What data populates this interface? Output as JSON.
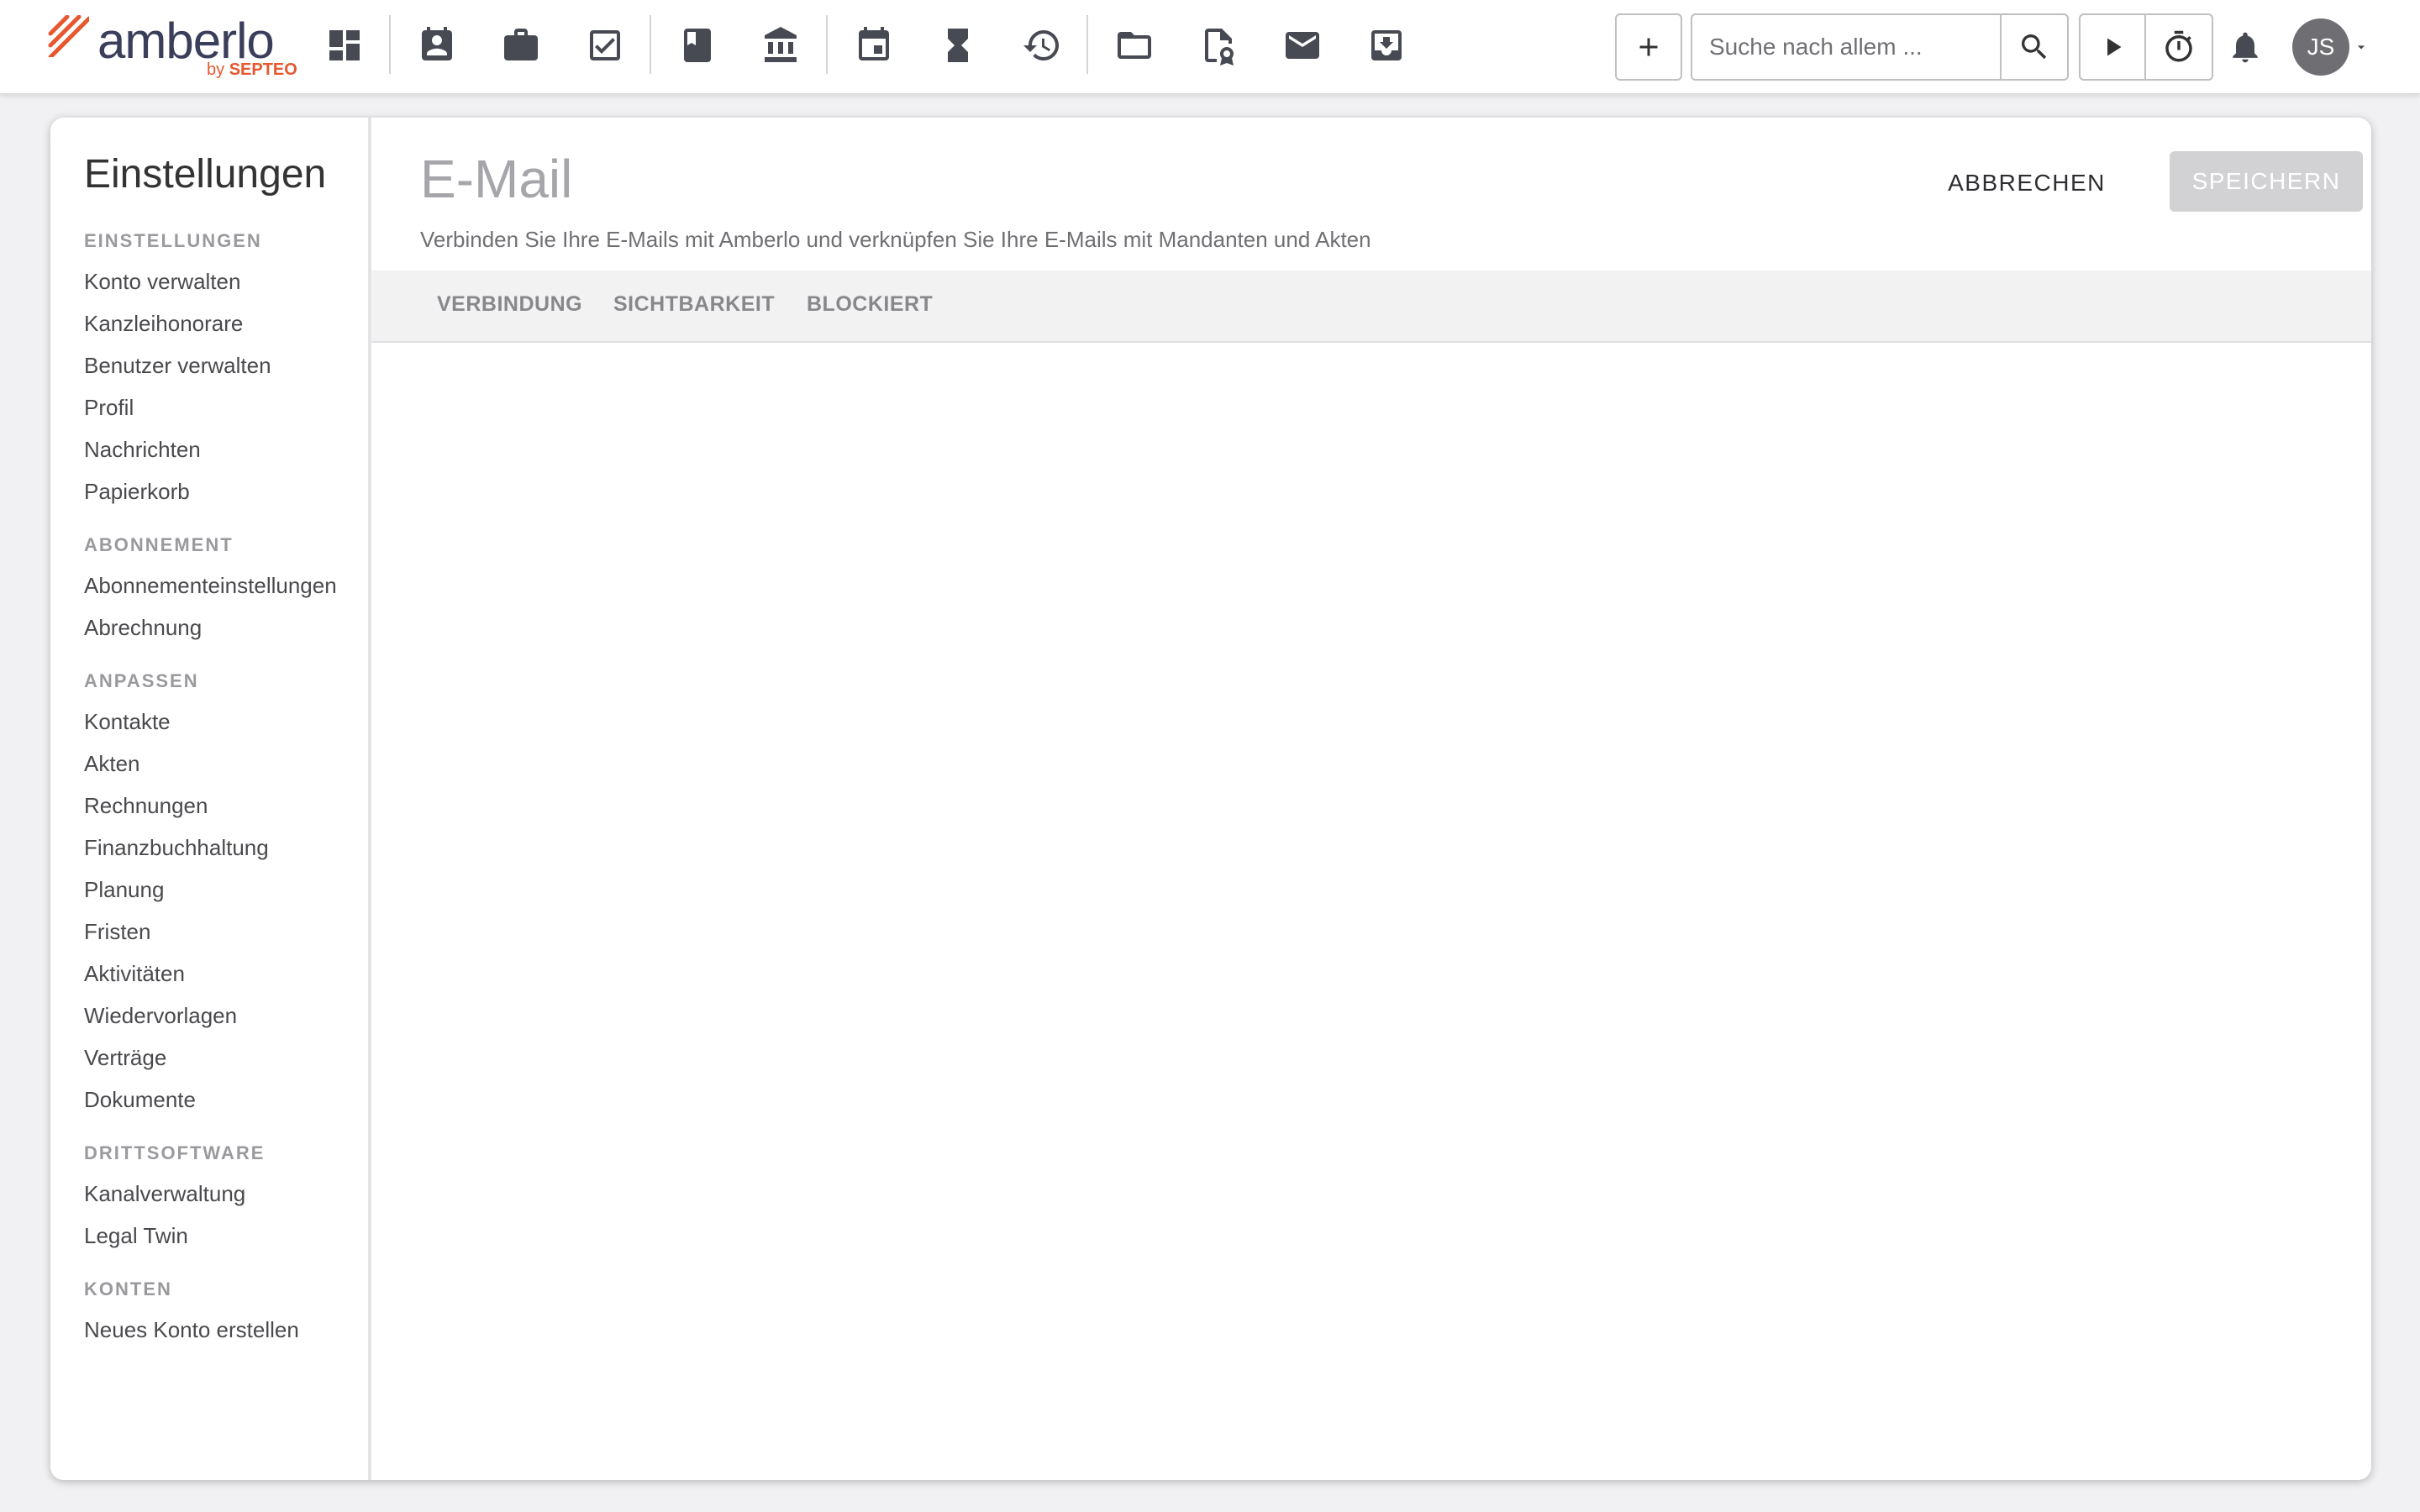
{
  "app": {
    "logo_text": "amberlo",
    "logo_by": "by",
    "logo_brand": "SEPTEO",
    "brand_color": "#e8572e"
  },
  "topbar": {
    "icons": [
      "dashboard-icon",
      "contacts-icon",
      "briefcase-icon",
      "tasks-icon",
      "book-icon",
      "bank-icon",
      "calendar-icon",
      "hourglass-icon",
      "billing-history-icon",
      "folder-icon",
      "document-seal-icon",
      "mail-icon",
      "inbox-download-icon"
    ],
    "search": {
      "placeholder": "Suche nach allem ..."
    },
    "avatar_initials": "JS"
  },
  "sidebar": {
    "title": "Einstellungen",
    "sections": [
      {
        "label": "EINSTELLUNGEN",
        "items": [
          "Konto verwalten",
          "Kanzleihonorare",
          "Benutzer verwalten",
          "Profil",
          "Nachrichten",
          "Papierkorb"
        ]
      },
      {
        "label": "ABONNEMENT",
        "items": [
          "Abonnementeinstellungen",
          "Abrechnung"
        ]
      },
      {
        "label": "ANPASSEN",
        "items": [
          "Kontakte",
          "Akten",
          "Rechnungen",
          "Finanzbuchhaltung",
          "Planung",
          "Fristen",
          "Aktivitäten",
          "Wiedervorlagen",
          "Verträge",
          "Dokumente"
        ]
      },
      {
        "label": "DRITTSOFTWARE",
        "items": [
          "Kanalverwaltung",
          "Legal Twin"
        ]
      },
      {
        "label": "KONTEN",
        "items": [
          "Neues Konto erstellen"
        ]
      }
    ]
  },
  "main": {
    "title": "E-Mail",
    "description": "Verbinden Sie Ihre E-Mails mit Amberlo und verknüpfen Sie Ihre E-Mails mit Mandanten und Akten",
    "cancel_label": "ABBRECHEN",
    "save_label": "SPEICHERN",
    "tabs": [
      {
        "label": "VERBINDUNG"
      },
      {
        "label": "SICHTBARKEIT"
      },
      {
        "label": "BLOCKIERT"
      }
    ]
  }
}
